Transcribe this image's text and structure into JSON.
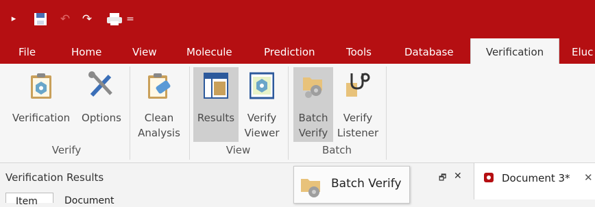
{
  "colors": {
    "accent": "#b50f12",
    "ribbon_bg": "#f6f6f6",
    "selected_bg": "#cfcfcf"
  },
  "quick_access": {
    "app_icon": "app-logo-icon",
    "save_icon": "save-icon",
    "undo_icon": "undo-icon",
    "redo_icon": "redo-icon",
    "print_icon": "print-icon",
    "customize_glyph": "="
  },
  "tabs": [
    {
      "label": "File"
    },
    {
      "label": "Home"
    },
    {
      "label": "View"
    },
    {
      "label": "Molecule"
    },
    {
      "label": "Prediction"
    },
    {
      "label": "Tools"
    },
    {
      "label": "Database"
    },
    {
      "label": "Verification",
      "active": true
    },
    {
      "label": "Eluc"
    }
  ],
  "ribbon": {
    "groups": [
      {
        "name": "Verify",
        "buttons": [
          {
            "label": "Verification"
          },
          {
            "label": "Options"
          }
        ]
      },
      {
        "name": "",
        "buttons": [
          {
            "label1": "Clean",
            "label2": "Analysis"
          }
        ]
      },
      {
        "name": "View",
        "buttons": [
          {
            "label": "Results",
            "selected": true
          },
          {
            "label1": "Verify",
            "label2": "Viewer"
          }
        ]
      },
      {
        "name": "Batch",
        "buttons": [
          {
            "label1": "Batch",
            "label2": "Verify",
            "selected": true
          },
          {
            "label1": "Verify",
            "label2": "Listener"
          }
        ]
      }
    ]
  },
  "panes": {
    "left_title": "Verification Results",
    "left_tabs": [
      "Item",
      "Document"
    ],
    "tooltip": "Batch Verify",
    "pin_glyph": "🗗",
    "close_glyph": "✕",
    "doc_tab": "Document 3*",
    "doc_close_glyph": "✕"
  }
}
